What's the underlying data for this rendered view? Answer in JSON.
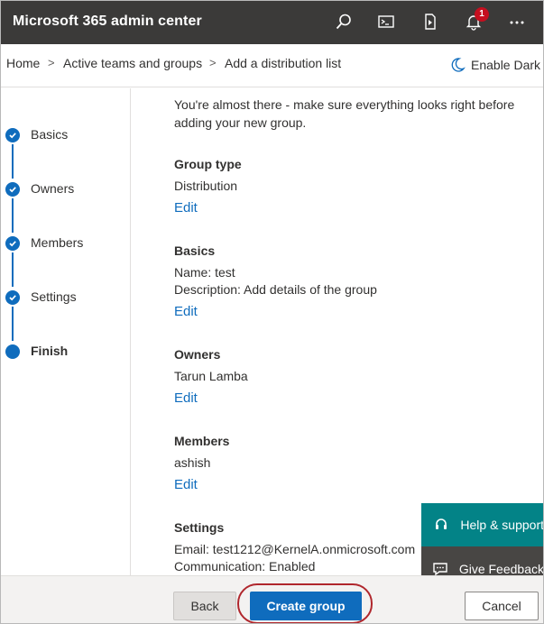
{
  "app": {
    "title": "Microsoft 365 admin center"
  },
  "notifications": {
    "count": "1"
  },
  "breadcrumb": {
    "items": [
      "Home",
      "Active teams and groups",
      "Add a distribution list"
    ],
    "separator": ">"
  },
  "dark_mode": {
    "label": "Enable Dark"
  },
  "steps": [
    {
      "label": "Basics",
      "state": "completed"
    },
    {
      "label": "Owners",
      "state": "completed"
    },
    {
      "label": "Members",
      "state": "completed"
    },
    {
      "label": "Settings",
      "state": "completed"
    },
    {
      "label": "Finish",
      "state": "current"
    }
  ],
  "review": {
    "intro": "You're almost there - make sure everything looks right before adding your new group.",
    "edit_label": "Edit",
    "sections": [
      {
        "title": "Group type",
        "lines": [
          "Distribution"
        ]
      },
      {
        "title": "Basics",
        "lines": [
          "Name: test",
          "Description: Add details of the group"
        ]
      },
      {
        "title": "Owners",
        "lines": [
          "Tarun Lamba"
        ]
      },
      {
        "title": "Members",
        "lines": [
          "ashish"
        ]
      },
      {
        "title": "Settings",
        "lines": [
          "Email: test1212@KernelA.onmicrosoft.com",
          "Communication: Enabled"
        ]
      }
    ]
  },
  "floating": {
    "help_label": "Help & support",
    "feedback_label": "Give Feedback"
  },
  "footer": {
    "back_label": "Back",
    "create_label": "Create group",
    "cancel_label": "Cancel"
  },
  "colors": {
    "topbar": "#3b3a39",
    "accent": "#0f6cbd",
    "help": "#038387",
    "feedback": "#484644",
    "badge": "#c50f1f",
    "highlight": "#b0272d"
  }
}
